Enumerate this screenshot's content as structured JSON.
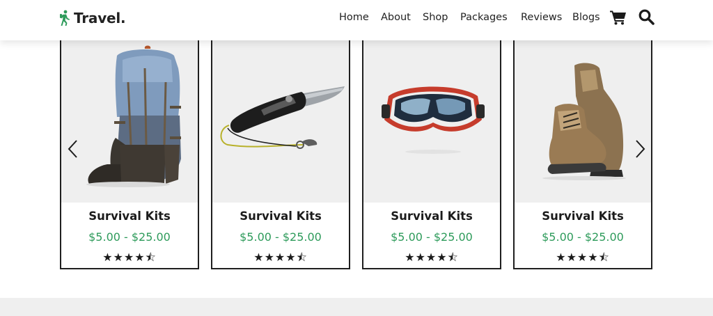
{
  "header": {
    "logo_text": "Travel.",
    "accent_color": "#2e9b5b",
    "nav": [
      "Home",
      "About",
      "Shop",
      "Packages",
      "Reviews",
      "Blogs"
    ],
    "icons": [
      "cart-icon",
      "search-icon"
    ]
  },
  "products": [
    {
      "title": "Survival Kits",
      "price": "$5.00 - $25.00",
      "rating": 4.5,
      "image": "backpack"
    },
    {
      "title": "Survival Kits",
      "price": "$5.00 - $25.00",
      "rating": 4.5,
      "image": "knife"
    },
    {
      "title": "Survival Kits",
      "price": "$5.00 - $25.00",
      "rating": 4.5,
      "image": "goggles"
    },
    {
      "title": "Survival Kits",
      "price": "$5.00 - $25.00",
      "rating": 4.5,
      "image": "boots"
    }
  ],
  "slider": {
    "prev_icon": "chevron-left-icon",
    "next_icon": "chevron-right-icon"
  }
}
